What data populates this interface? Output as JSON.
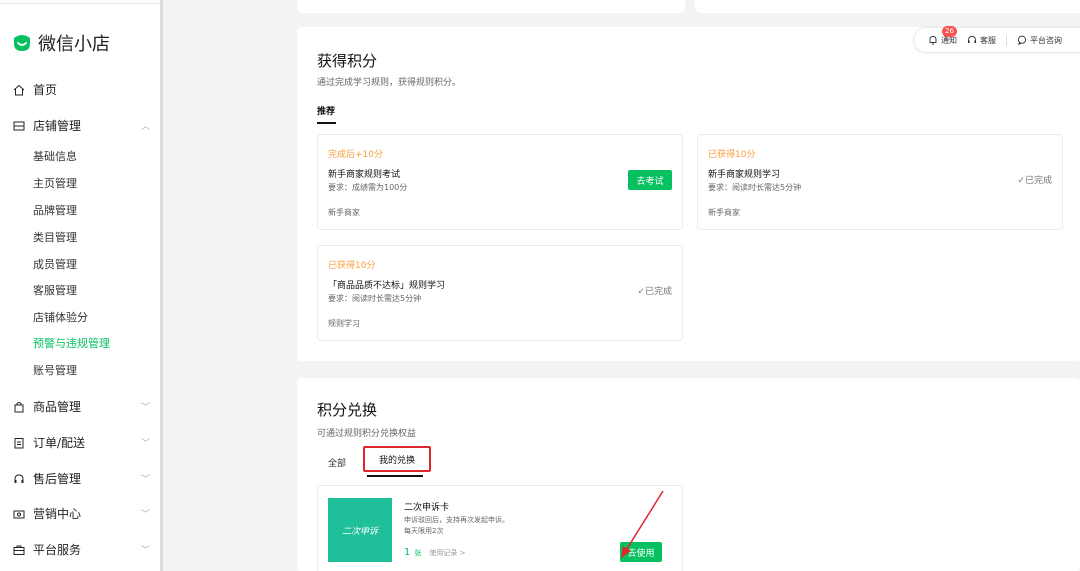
{
  "sidebar": {
    "app_name": "微信小店",
    "home": "首页",
    "store_mgmt": "店铺管理",
    "sub_items": [
      "基础信息",
      "主页管理",
      "品牌管理",
      "类目管理",
      "成员管理",
      "客服管理",
      "店铺体验分",
      "预警与违规管理",
      "账号管理"
    ],
    "active_sub": "预警与违规管理",
    "goods": "商品管理",
    "orders": "订单/配送",
    "aftersale": "售后管理",
    "marketing": "营销中心",
    "platform": "平台服务"
  },
  "toolbar": {
    "notify": "通知",
    "notify_count": "26",
    "service": "客服",
    "consult": "平台咨询"
  },
  "earn": {
    "title": "获得积分",
    "desc": "通过完成学习规则，获得规则积分。",
    "tab": "推荐",
    "cards": [
      {
        "tag": "完成后+10分",
        "name": "新手商家规则考试",
        "req": "要求：成绩需为100分",
        "category": "新手商家",
        "action": "去考试"
      },
      {
        "tag": "已获得10分",
        "name": "新手商家规则学习",
        "req": "要求：阅读时长需达5分钟",
        "category": "新手商家",
        "status": "✓已完成"
      },
      {
        "tag": "已获得10分",
        "name": "「商品品质不达标」规则学习",
        "req": "要求：阅读时长需达5分钟",
        "category": "规则学习",
        "status": "✓已完成"
      }
    ]
  },
  "exchange": {
    "title": "积分兑换",
    "desc": "可通过规则积分兑换权益",
    "tab_all": "全部",
    "tab_mine": "我的兑换",
    "item": {
      "thumb_text": "二次申诉",
      "name": "二次申诉卡",
      "desc1": "申诉驳回后，支持再次发起申诉。",
      "desc2": "每天限用2次",
      "count": "1",
      "unit": "张",
      "record": "使用记录 >",
      "button": "去使用"
    }
  },
  "colors": {
    "accent": "#07c160",
    "tag_orange": "#fa9d3b",
    "highlight_red": "#e0262d"
  }
}
